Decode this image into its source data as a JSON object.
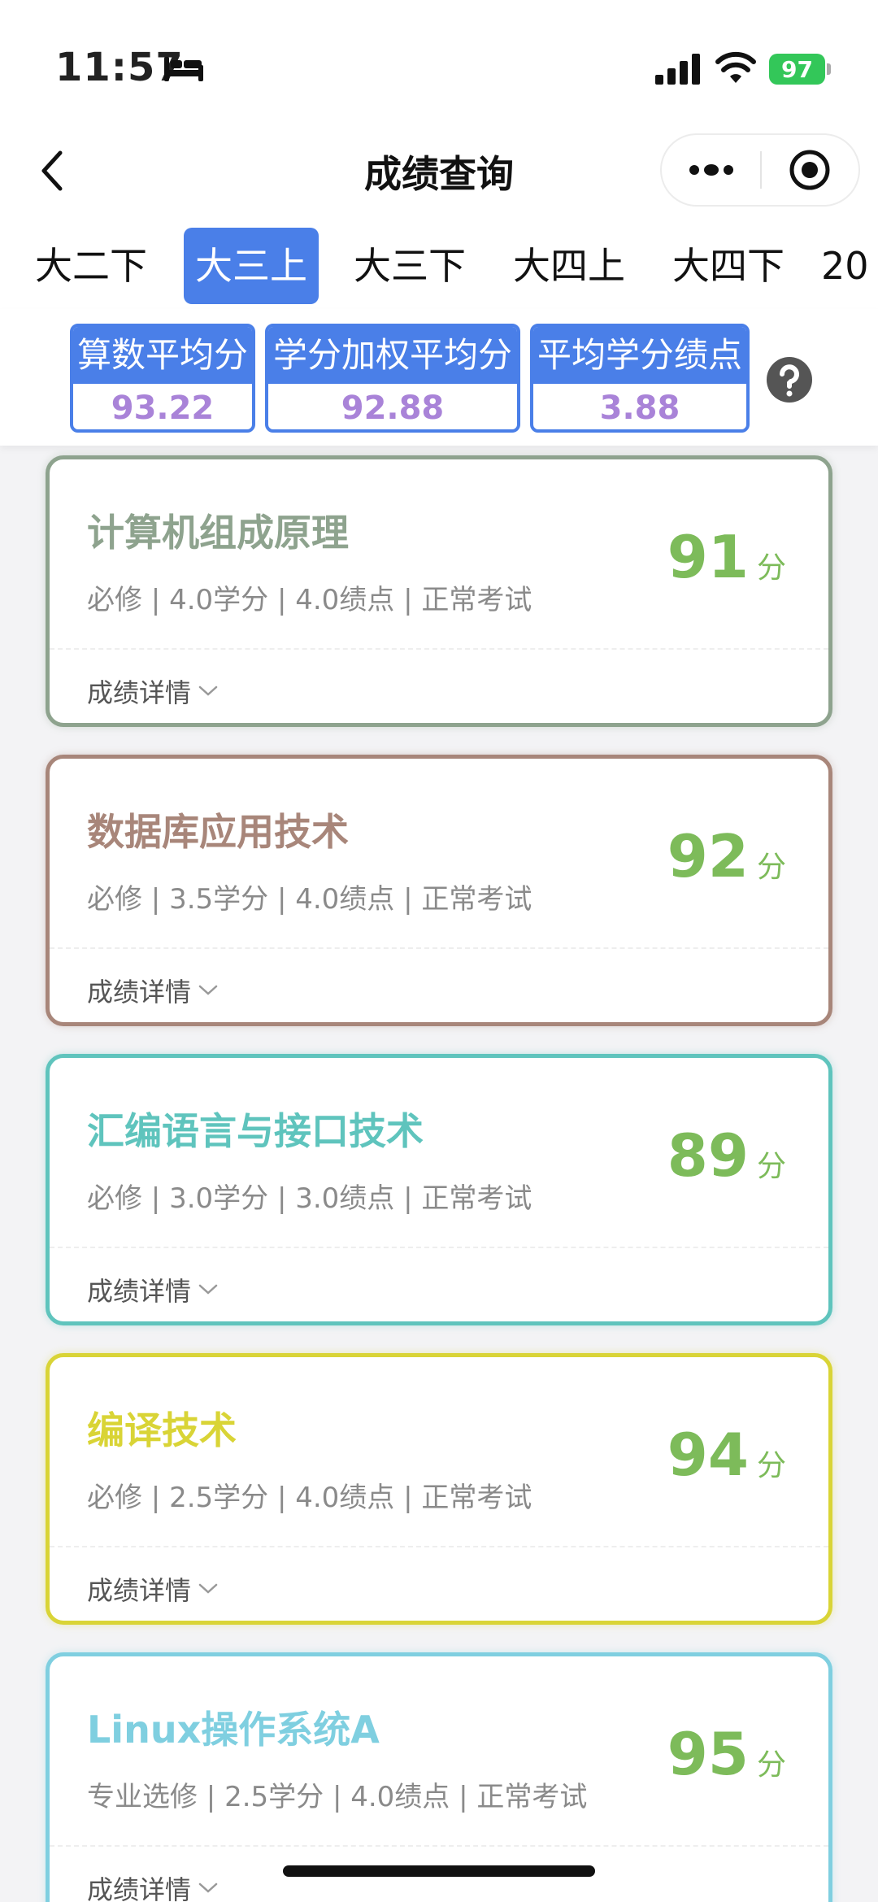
{
  "status_bar": {
    "time": "11:57",
    "battery": "97"
  },
  "nav": {
    "title": "成绩查询"
  },
  "tabs": [
    {
      "label": "大二下",
      "active": false
    },
    {
      "label": "大三上",
      "active": true
    },
    {
      "label": "大三下",
      "active": false
    },
    {
      "label": "大四上",
      "active": false
    },
    {
      "label": "大四下",
      "active": false
    },
    {
      "label": "20",
      "active": false
    }
  ],
  "summary": {
    "arith_avg_label": "算数平均分",
    "arith_avg_value": "93.22",
    "weighted_avg_label": "学分加权平均分",
    "weighted_avg_value": "92.88",
    "gpa_label": "平均学分绩点",
    "gpa_value": "3.88"
  },
  "courses": [
    {
      "name": "计算机组成原理",
      "meta": "必修 | 4.0学分 | 4.0绩点 | 正常考试",
      "score": "91",
      "unit": "分",
      "detail": "成绩详情",
      "color": "#8ea38e"
    },
    {
      "name": "数据库应用技术",
      "meta": "必修 | 3.5学分 | 4.0绩点 | 正常考试",
      "score": "92",
      "unit": "分",
      "detail": "成绩详情",
      "color": "#a8867a"
    },
    {
      "name": "汇编语言与接口技术",
      "meta": "必修 | 3.0学分 | 3.0绩点 | 正常考试",
      "score": "89",
      "unit": "分",
      "detail": "成绩详情",
      "color": "#5fc4bd"
    },
    {
      "name": "编译技术",
      "meta": "必修 | 2.5学分 | 4.0绩点 | 正常考试",
      "score": "94",
      "unit": "分",
      "detail": "成绩详情",
      "color": "#d9d436"
    },
    {
      "name": "Linux操作系统A",
      "meta": "专业选修 | 2.5学分 | 4.0绩点 | 正常考试",
      "score": "95",
      "unit": "分",
      "detail": "成绩详情",
      "color": "#7fcfe0"
    }
  ],
  "colors": {
    "accent": "#4a7fe8",
    "score_green": "#7dbb5a",
    "stat_value_purple": "#a983d8"
  },
  "icons": [
    "back-chevron-icon",
    "more-dots-icon",
    "target-close-icon",
    "question-icon",
    "chevron-down-icon",
    "sleep-bed-icon",
    "signal-icon",
    "wifi-icon"
  ]
}
